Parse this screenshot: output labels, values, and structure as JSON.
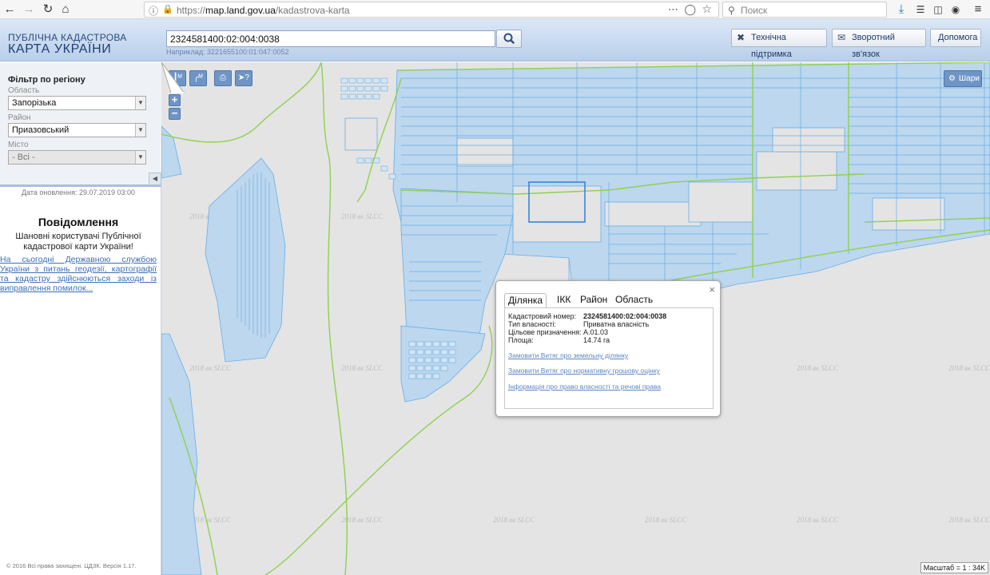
{
  "browser": {
    "url_prefix": "https://",
    "url_host": "map.land.gov.ua",
    "url_path": "/kadastrova-karta",
    "search_placeholder": "Поиск"
  },
  "header": {
    "logo_line1": "ПУБЛІЧНА КАДАСТРОВА",
    "logo_line2": "КАРТА УКРАЇНИ",
    "search_value": "2324581400:02:004:0038",
    "example_text": "Наприклад: 3221655100:01:047:0052",
    "support_label": "Технічна підтримка",
    "feedback_label": "Зворотний зв'язок",
    "help_label": "Допомога"
  },
  "filter": {
    "title": "Фільтр по регіону",
    "oblast_label": "Область",
    "oblast_value": "Запорізька",
    "rayon_label": "Район",
    "rayon_value": "Приазовський",
    "misto_label": "Місто",
    "misto_value": "- Всі -"
  },
  "panel": {
    "update_date": "Дата оновлення: 29.07.2019 03:00",
    "notice_title": "Повідомлення",
    "notice_text": "Шановні користувачі Публічної кадастрової карти України!",
    "notice_link": "На сьогодні Державною службою України з питань геодезії, картографії та кадастру здійснюються заходи із виправлення помилок...",
    "copyright": "© 2016 Всі права захищені. ЦДЗК. Версія 1.17."
  },
  "map": {
    "layers_label": "Шари",
    "zoom_in": "+",
    "zoom_out": "−",
    "scale": "Масштаб = 1 : 34K",
    "watermark": "2018 вк SLCC"
  },
  "popup": {
    "tabs": [
      "Ділянка",
      "ІКК",
      "Район",
      "Область"
    ],
    "close": "×",
    "fields": [
      {
        "key": "Кадастровий номер:",
        "value": "2324581400:02:004:0038"
      },
      {
        "key": "Тип власності:",
        "value": "Приватна власність"
      },
      {
        "key": "Цільове призначення:",
        "value": "А.01.03"
      },
      {
        "key": "Площа:",
        "value": "14.74 га"
      }
    ],
    "links": [
      "Замовити Витяг про земельну ділянку",
      "Замовити Витяг про нормативну грошову оцінку",
      "Інформація про право власності та речові права"
    ]
  },
  "colors": {
    "parcel_fill": "#bcd7ee",
    "parcel_stroke": "#69aee6",
    "boundary": "#8fd14f",
    "header_gradient_top": "#dbe7f6",
    "button_blue": "#6f95c6"
  }
}
